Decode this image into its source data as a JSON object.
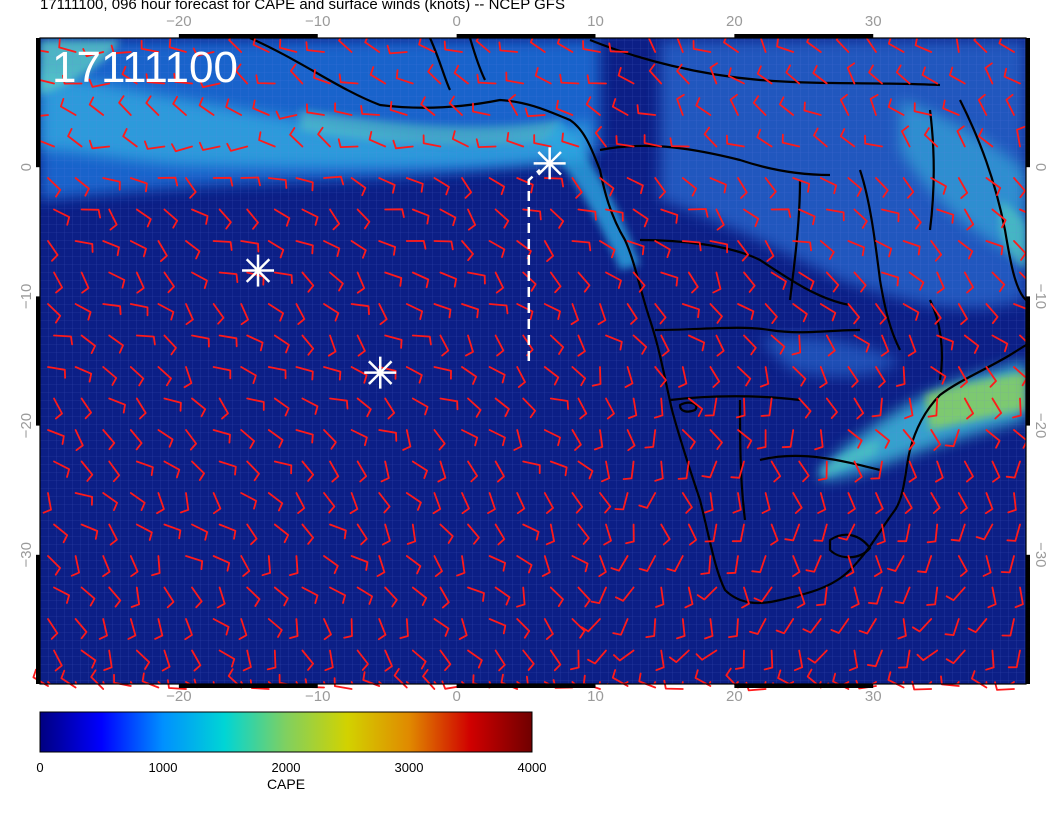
{
  "title": "17111100, 096 hour forecast for CAPE and surface winds (knots) -- NCEP GFS",
  "timestamp": "17111100",
  "map": {
    "lon_range": [
      -30,
      41
    ],
    "lat_range": [
      -40,
      10
    ],
    "lon_ticks": [
      "−20",
      "−10",
      "0",
      "10",
      "20",
      "30"
    ],
    "lat_ticks": [
      "0",
      "−10",
      "−20",
      "−30"
    ],
    "ocean_color": "#0c1f86",
    "barb_color": "#ff1a1a",
    "coast_color": "#000000"
  },
  "markers": [
    {
      "lon": -14.3,
      "lat": -8.0
    },
    {
      "lon": -5.5,
      "lat": -15.9
    },
    {
      "lon": 6.7,
      "lat": 0.3
    }
  ],
  "track": [
    {
      "lon": 5.2,
      "lat": -15.0
    },
    {
      "lon": 5.2,
      "lat": -1.0
    },
    {
      "lon": 6.0,
      "lat": -0.2
    }
  ],
  "colorbar": {
    "label": "CAPE",
    "ticks": [
      "0",
      "1000",
      "2000",
      "3000",
      "4000"
    ],
    "range": [
      0,
      4000
    ],
    "colors": [
      "#000080",
      "#0000ff",
      "#0090ff",
      "#00d5d5",
      "#80d060",
      "#d2d200",
      "#e08a00",
      "#d00000",
      "#700000"
    ]
  }
}
